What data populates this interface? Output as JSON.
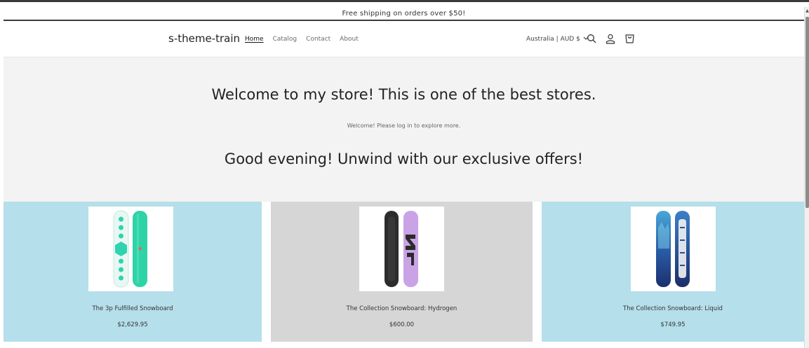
{
  "announcement": {
    "text": "Free shipping on orders over $50!"
  },
  "header": {
    "logo": "s-theme-train",
    "nav": [
      {
        "label": "Home",
        "active": true
      },
      {
        "label": "Catalog",
        "active": false
      },
      {
        "label": "Contact",
        "active": false
      },
      {
        "label": "About",
        "active": false
      }
    ],
    "localization": "Australia | AUD $",
    "icons": [
      "search-icon",
      "account-icon",
      "cart-icon"
    ]
  },
  "hero": {
    "title": "Welcome to my store! This is one of the best stores.",
    "subtitle": "Welcome! Please log in to explore more.",
    "title2": "Good evening! Unwind with our exclusive offers!"
  },
  "products": [
    {
      "name": "The 3p Fulfilled Snowboard",
      "price": "$2,629.95",
      "background": "#b5dfea"
    },
    {
      "name": "The Collection Snowboard: Hydrogen",
      "price": "$600.00",
      "background": "#d6d6d6"
    },
    {
      "name": "The Collection Snowboard: Liquid",
      "price": "$749.95",
      "background": "#b5dfea"
    }
  ]
}
